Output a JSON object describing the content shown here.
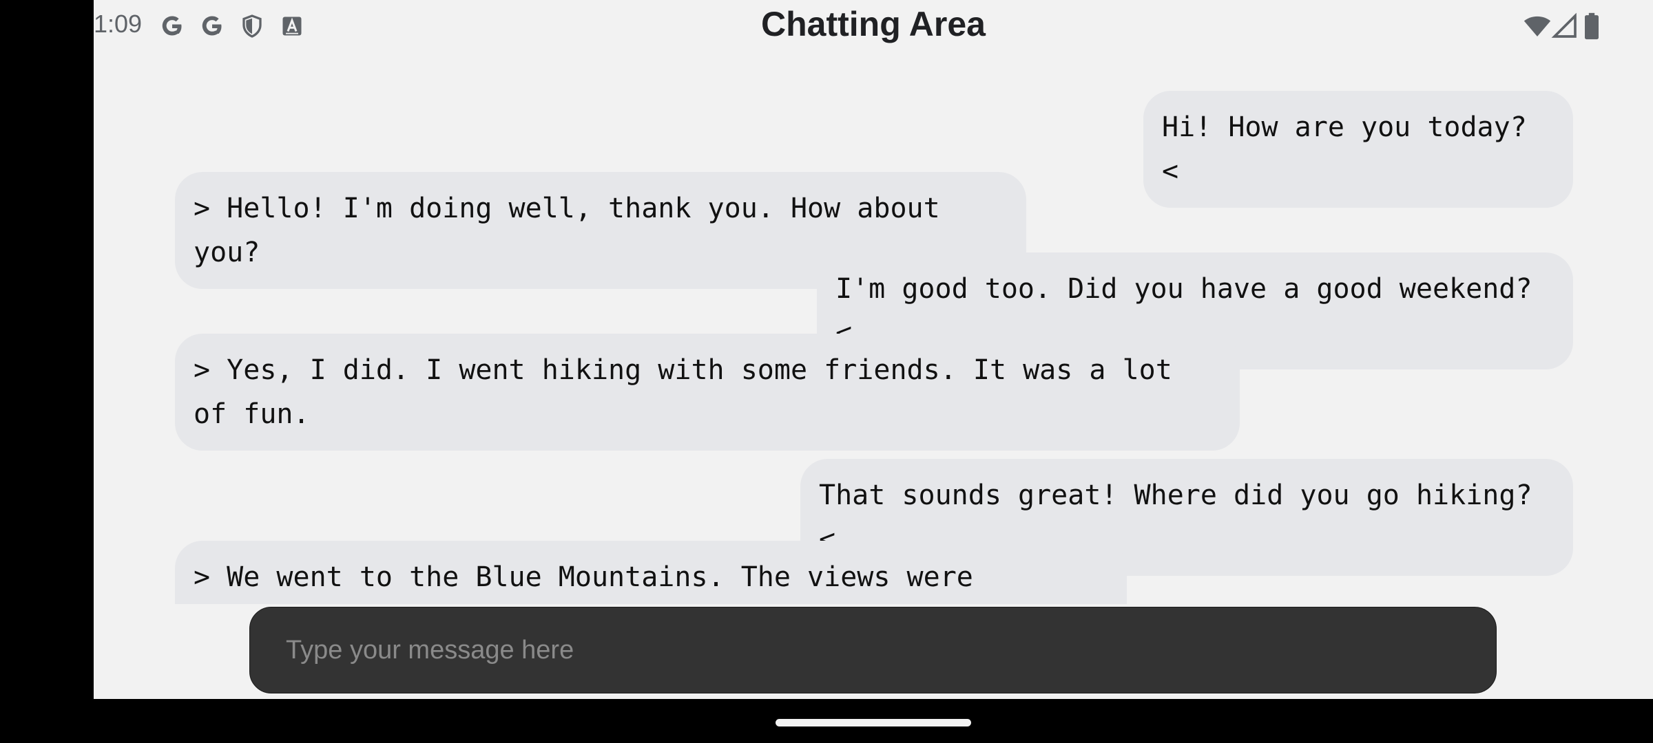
{
  "status_bar": {
    "time": "1:09",
    "icons": [
      "google-icon",
      "google-icon",
      "shield-icon",
      "font-a-icon"
    ],
    "right_icons": [
      "wifi-icon",
      "cell-signal-icon",
      "battery-icon"
    ]
  },
  "header": {
    "title": "Chatting Area"
  },
  "messages": [
    {
      "side": "user",
      "text": "Hi! How are you today? <"
    },
    {
      "side": "bot",
      "text": "> Hello! I'm doing well, thank you. How about you?"
    },
    {
      "side": "user",
      "text": "I'm good too. Did you have a good weekend? <"
    },
    {
      "side": "bot",
      "text": "> Yes, I did. I went hiking with some friends. It was a lot of fun."
    },
    {
      "side": "user",
      "text": "That sounds great! Where did you go hiking? <"
    },
    {
      "side": "bot",
      "text": "> We went to the Blue Mountains. The views were amazing."
    }
  ],
  "composer": {
    "placeholder": "Type your message here",
    "value": ""
  },
  "colors": {
    "background": "#f2f2f2",
    "bubble": "#e6e7ea",
    "composer": "#333333",
    "frame": "#000000"
  }
}
